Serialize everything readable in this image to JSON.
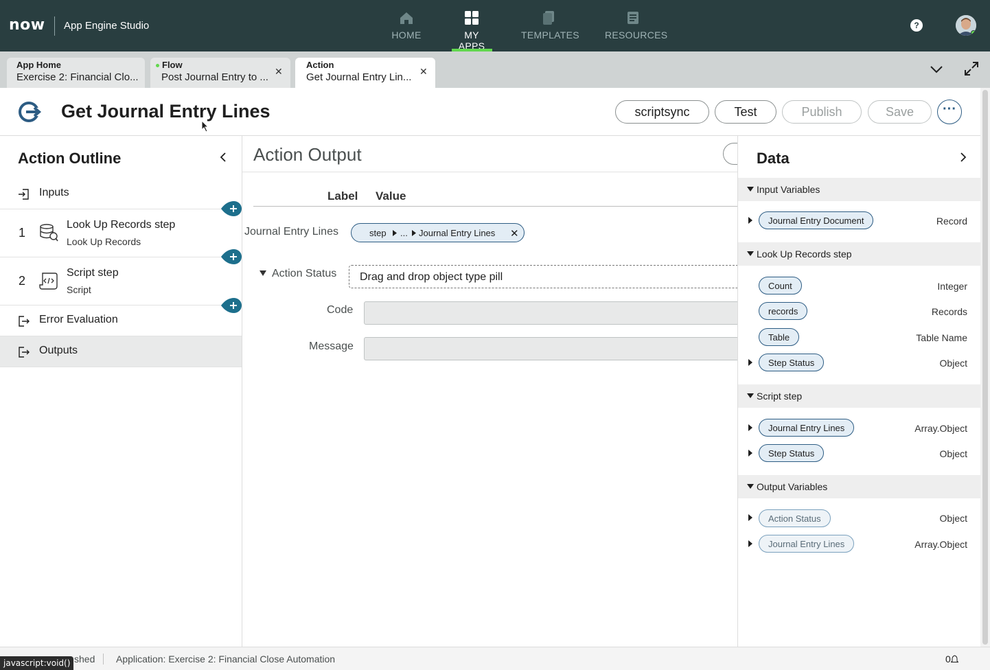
{
  "header": {
    "logo": "now",
    "app_name": "App Engine Studio",
    "nav": [
      {
        "label": "HOME",
        "icon": "home-icon"
      },
      {
        "label": "MY APPS",
        "icon": "apps-grid-icon"
      },
      {
        "label": "TEMPLATES",
        "icon": "templates-icon"
      },
      {
        "label": "RESOURCES",
        "icon": "resources-icon"
      }
    ],
    "help": "?"
  },
  "tabs": [
    {
      "kind": "App Home",
      "value": "Exercise 2: Financial Clo..."
    },
    {
      "kind": "Flow",
      "value": "Post Journal Entry to ..."
    },
    {
      "kind": "Action",
      "value": "Get Journal Entry Lin..."
    }
  ],
  "page": {
    "title": "Get Journal Entry Lines",
    "buttons": {
      "scriptsync": "scriptsync",
      "test": "Test",
      "publish": "Publish",
      "save": "Save",
      "more": "···"
    }
  },
  "outline": {
    "title": "Action Outline",
    "inputs": "Inputs",
    "steps": [
      {
        "num": "1",
        "title": "Look Up Records step",
        "sub": "Look Up Records"
      },
      {
        "num": "2",
        "title": "Script step",
        "sub": "Script"
      }
    ],
    "error_evaluation": "Error Evaluation",
    "outputs": "Outputs"
  },
  "main": {
    "title": "Action Output",
    "col_label": "Label",
    "col_value": "Value",
    "journal_label": "Journal Entry Lines",
    "pill": {
      "part1": "step",
      "part2": "...",
      "part3": "Journal Entry Lines"
    },
    "action_status": "Action Status",
    "drop_placeholder": "Drag and drop object type pill",
    "code_label": "Code",
    "message_label": "Message"
  },
  "data_panel": {
    "title": "Data",
    "sections": [
      {
        "title": "Input Variables",
        "items": [
          {
            "pill": "Journal Entry Document",
            "type": "Record"
          }
        ]
      },
      {
        "title": "Look Up Records step",
        "items": [
          {
            "pill": "Count",
            "type": "Integer"
          },
          {
            "pill": "records",
            "type": "Records"
          },
          {
            "pill": "Table",
            "type": "Table Name"
          },
          {
            "pill": "Step Status",
            "type": "Object"
          }
        ]
      },
      {
        "title": "Script step",
        "items": [
          {
            "pill": "Journal Entry Lines",
            "type": "Array.Object"
          },
          {
            "pill": "Step Status",
            "type": "Object"
          }
        ]
      },
      {
        "title": "Output Variables",
        "items": [
          {
            "pill": "Action Status",
            "type": "Object"
          },
          {
            "pill": "Journal Entry Lines",
            "type": "Array.Object"
          }
        ]
      }
    ]
  },
  "footer": {
    "status": "shed",
    "application": "Application: Exercise 2: Financial Close Automation",
    "notifications": "0"
  },
  "statusbar_url": "javascript:void()",
  "colors": {
    "header_bg": "#293e40",
    "accent_green": "#62d84e",
    "pill_border": "#2d5c83",
    "add_button": "#1d6f8c"
  }
}
